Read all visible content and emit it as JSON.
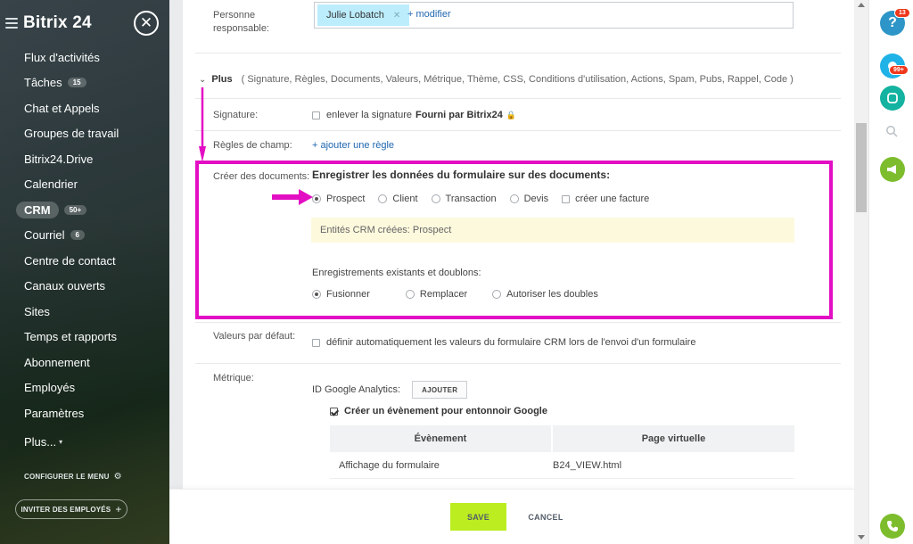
{
  "sidebar": {
    "logo": "Bitrix 24",
    "items": [
      {
        "label": "Flux d'activités"
      },
      {
        "label": "Tâches",
        "counter": "15"
      },
      {
        "label": "Chat et Appels"
      },
      {
        "label": "Groupes de travail"
      },
      {
        "label": "Bitrix24.Drive"
      },
      {
        "label": "Calendrier"
      },
      {
        "label": "CRM",
        "counter": "50+"
      },
      {
        "label": "Courriel",
        "counter": "6"
      },
      {
        "label": "Centre de contact"
      },
      {
        "label": "Canaux ouverts"
      },
      {
        "label": "Sites"
      },
      {
        "label": "Temps et rapports"
      },
      {
        "label": "Abonnement"
      },
      {
        "label": "Employés"
      },
      {
        "label": "Paramètres"
      },
      {
        "label": "Plus..."
      }
    ],
    "configure_menu": "CONFIGURER LE MENU",
    "invite": "INVITER DES EMPLOYÉS"
  },
  "form": {
    "responsible": {
      "label": "Personne responsable:",
      "tag": "Julie Lobatch",
      "modify": "+ modifier"
    },
    "plus": {
      "title": "Plus",
      "items": "( Signature, Règles, Documents, Valeurs, Métrique, Thème, CSS, Conditions d'utilisation, Actions, Spam, Pubs, Rappel, Code  )"
    },
    "signature": {
      "label": "Signature:",
      "text": "enlever la signature",
      "bold": "Fourni par Bitrix24"
    },
    "field_rules": {
      "label": "Règles de champ:",
      "link": "+ ajouter une règle"
    },
    "create_docs": {
      "label": "Créer des documents:",
      "title": "Enregistrer les données du formulaire sur des documents:",
      "options": [
        "Prospect",
        "Client",
        "Transaction",
        "Devis"
      ],
      "selected": "Prospect",
      "invoice": "créer une facture",
      "notice": "Entités CRM créées: Prospect",
      "existing_label": "Enregistrements existants et doublons:",
      "existing_options": [
        "Fusionner",
        "Remplacer",
        "Autoriser les doubles"
      ],
      "existing_selected": "Fusionner"
    },
    "defaults": {
      "label": "Valeurs par défaut:",
      "text": "définir automatiquement les valeurs du formulaire CRM lors de l'envoi d'un formulaire"
    },
    "metrics": {
      "label": "Métrique:",
      "ga_label": "ID Google Analytics:",
      "add_button": "AJOUTER",
      "event_check": "Créer un évènement pour entonnoir Google",
      "table": {
        "headers": [
          "Évènement",
          "Page virtuelle"
        ],
        "rows": [
          [
            "Affichage du formulaire",
            "B24_VIEW.html"
          ]
        ]
      }
    }
  },
  "footer": {
    "save": "SAVE",
    "cancel": "CANCEL"
  },
  "rightbar": {
    "help_badge": "13",
    "notif_badge": "99+"
  },
  "colors": {
    "highlight": "#e30ec3",
    "save_button": "#bbed21",
    "tag_bg": "#bcedfc",
    "link": "#2067b0"
  }
}
